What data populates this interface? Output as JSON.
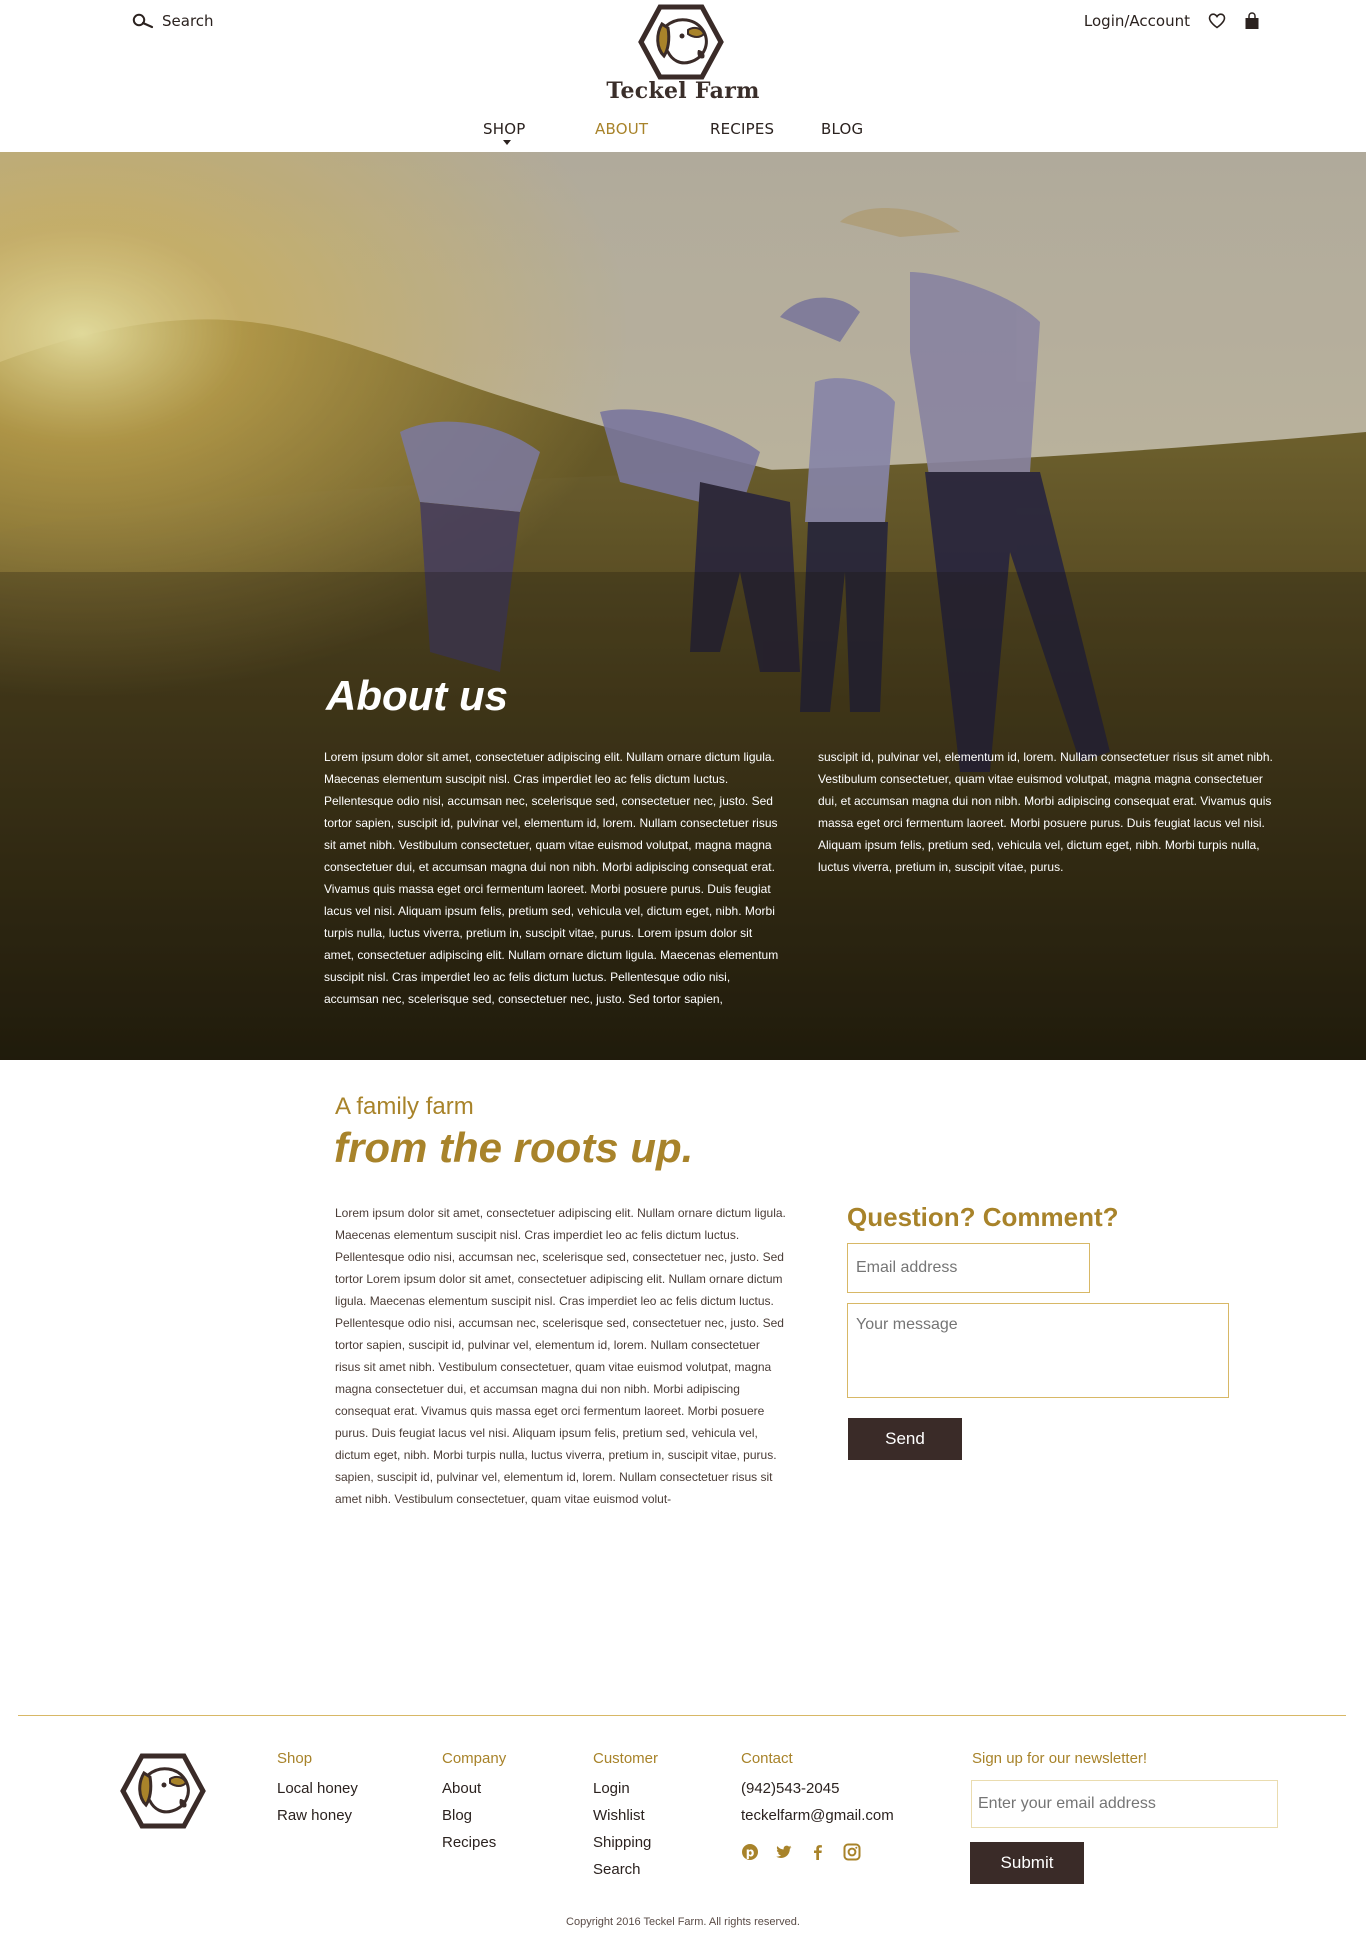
{
  "colors": {
    "accent": "#a8832a",
    "dark": "#3a2b28",
    "border": "#d8b866"
  },
  "header": {
    "search_label": "Search",
    "brand": "Teckel Farm",
    "login_label": "Login/Account",
    "icons": [
      "search-icon",
      "heart-icon",
      "shopping-bag-icon"
    ]
  },
  "nav": {
    "items": [
      {
        "label": "SHOP",
        "has_dropdown": true
      },
      {
        "label": "ABOUT",
        "active": true
      },
      {
        "label": "RECIPES"
      },
      {
        "label": "BLOG"
      }
    ]
  },
  "hero": {
    "title": "About us",
    "col1": "Lorem ipsum dolor sit amet, consectetuer adipiscing elit. Nullam ornare dictum ligula. Maecenas elementum suscipit nisl. Cras imperdiet leo ac felis dictum luctus. Pellentesque odio nisi, accumsan nec, scelerisque sed, consectetuer nec, justo. Sed tortor sapien, suscipit id, pulvinar vel, elementum id, lorem. Nullam consectetuer risus sit amet nibh. Vestibulum consectetuer, quam vitae euismod volutpat, magna magna consectetuer dui, et accumsan magna dui non nibh. Morbi adipiscing consequat erat. Vivamus quis massa eget orci fermentum laoreet. Morbi posuere purus. Duis feugiat lacus vel nisi. Aliquam ipsum felis, pretium sed, vehicula vel, dictum eget, nibh. Morbi turpis nulla, luctus viverra, pretium in, suscipit vitae, purus. Lorem ipsum dolor sit amet, consectetuer adipiscing elit. Nullam ornare dictum ligula. Maecenas elementum suscipit nisl. Cras imperdiet leo ac felis dictum luctus. Pellentesque odio nisi, accumsan nec, scelerisque sed, consectetuer nec, justo. Sed tortor sapien,",
    "col2": "suscipit id, pulvinar vel, elementum id, lorem. Nullam consectetuer risus sit amet nibh. Vestibulum consectetuer, quam vitae euismod volutpat, magna magna consectetuer dui, et accumsan magna dui non nibh. Morbi adipiscing consequat erat. Vivamus quis massa eget orci fermentum laoreet. Morbi posuere purus. Duis feugiat lacus vel nisi. Aliquam ipsum felis, pretium sed, vehicula vel, dictum eget, nibh. Morbi turpis nulla, luctus viverra, pretium in, suscipit vitae, purus."
  },
  "family": {
    "kicker": "A family farm",
    "title": "from the roots up.",
    "body": "Lorem ipsum dolor sit amet, consectetuer adipiscing elit. Nullam ornare dictum ligula. Maecenas elementum suscipit nisl. Cras imperdiet leo ac felis dictum luctus. Pellentesque odio nisi, accumsan nec, scelerisque sed, consectetuer nec, justo. Sed tortor Lorem ipsum dolor sit amet, consectetuer adipiscing elit. Nullam ornare dictum ligula. Maecenas elementum suscipit nisl. Cras imperdiet leo ac felis dictum luctus. Pellentesque odio nisi, accumsan nec, scelerisque sed, consectetuer nec, justo. Sed tortor sapien, suscipit id, pulvinar vel, elementum id, lorem. Nullam consectetuer risus sit amet nibh. Vestibulum consectetuer, quam vitae euismod volutpat, magna magna consectetuer dui, et accumsan magna dui non nibh. Morbi adipiscing consequat erat. Vivamus quis massa eget orci fermentum laoreet. Morbi posuere purus. Duis feugiat lacus vel nisi. Aliquam ipsum felis, pretium sed, vehicula vel, dictum eget, nibh. Morbi turpis nulla, luctus viverra, pretium in, suscipit vitae, purus. sapien, suscipit id, pulvinar vel, elementum id, lorem. Nullam consectetuer risus sit amet nibh. Vestibulum consectetuer, quam vitae euismod volut-"
  },
  "contact_form": {
    "title": "Question? Comment?",
    "email_placeholder": "Email address",
    "message_placeholder": "Your message",
    "send_label": "Send"
  },
  "footer": {
    "shop": {
      "heading": "Shop",
      "links": [
        "Local honey",
        "Raw honey"
      ]
    },
    "company": {
      "heading": "Company",
      "links": [
        "About",
        "Blog",
        "Recipes"
      ]
    },
    "customer": {
      "heading": "Customer",
      "links": [
        "Login",
        "Wishlist",
        "Shipping",
        "Search"
      ]
    },
    "contact": {
      "heading": "Contact",
      "phone": "(942)543-2045",
      "email": "teckelfarm@gmail.com",
      "socials": [
        "pinterest-icon",
        "twitter-icon",
        "facebook-icon",
        "instagram-icon"
      ]
    },
    "newsletter": {
      "title": "Sign up for our newsletter!",
      "placeholder": "Enter your email address",
      "submit_label": "Submit"
    },
    "copyright": "Copyright 2016 Teckel Farm. All rights reserved."
  }
}
